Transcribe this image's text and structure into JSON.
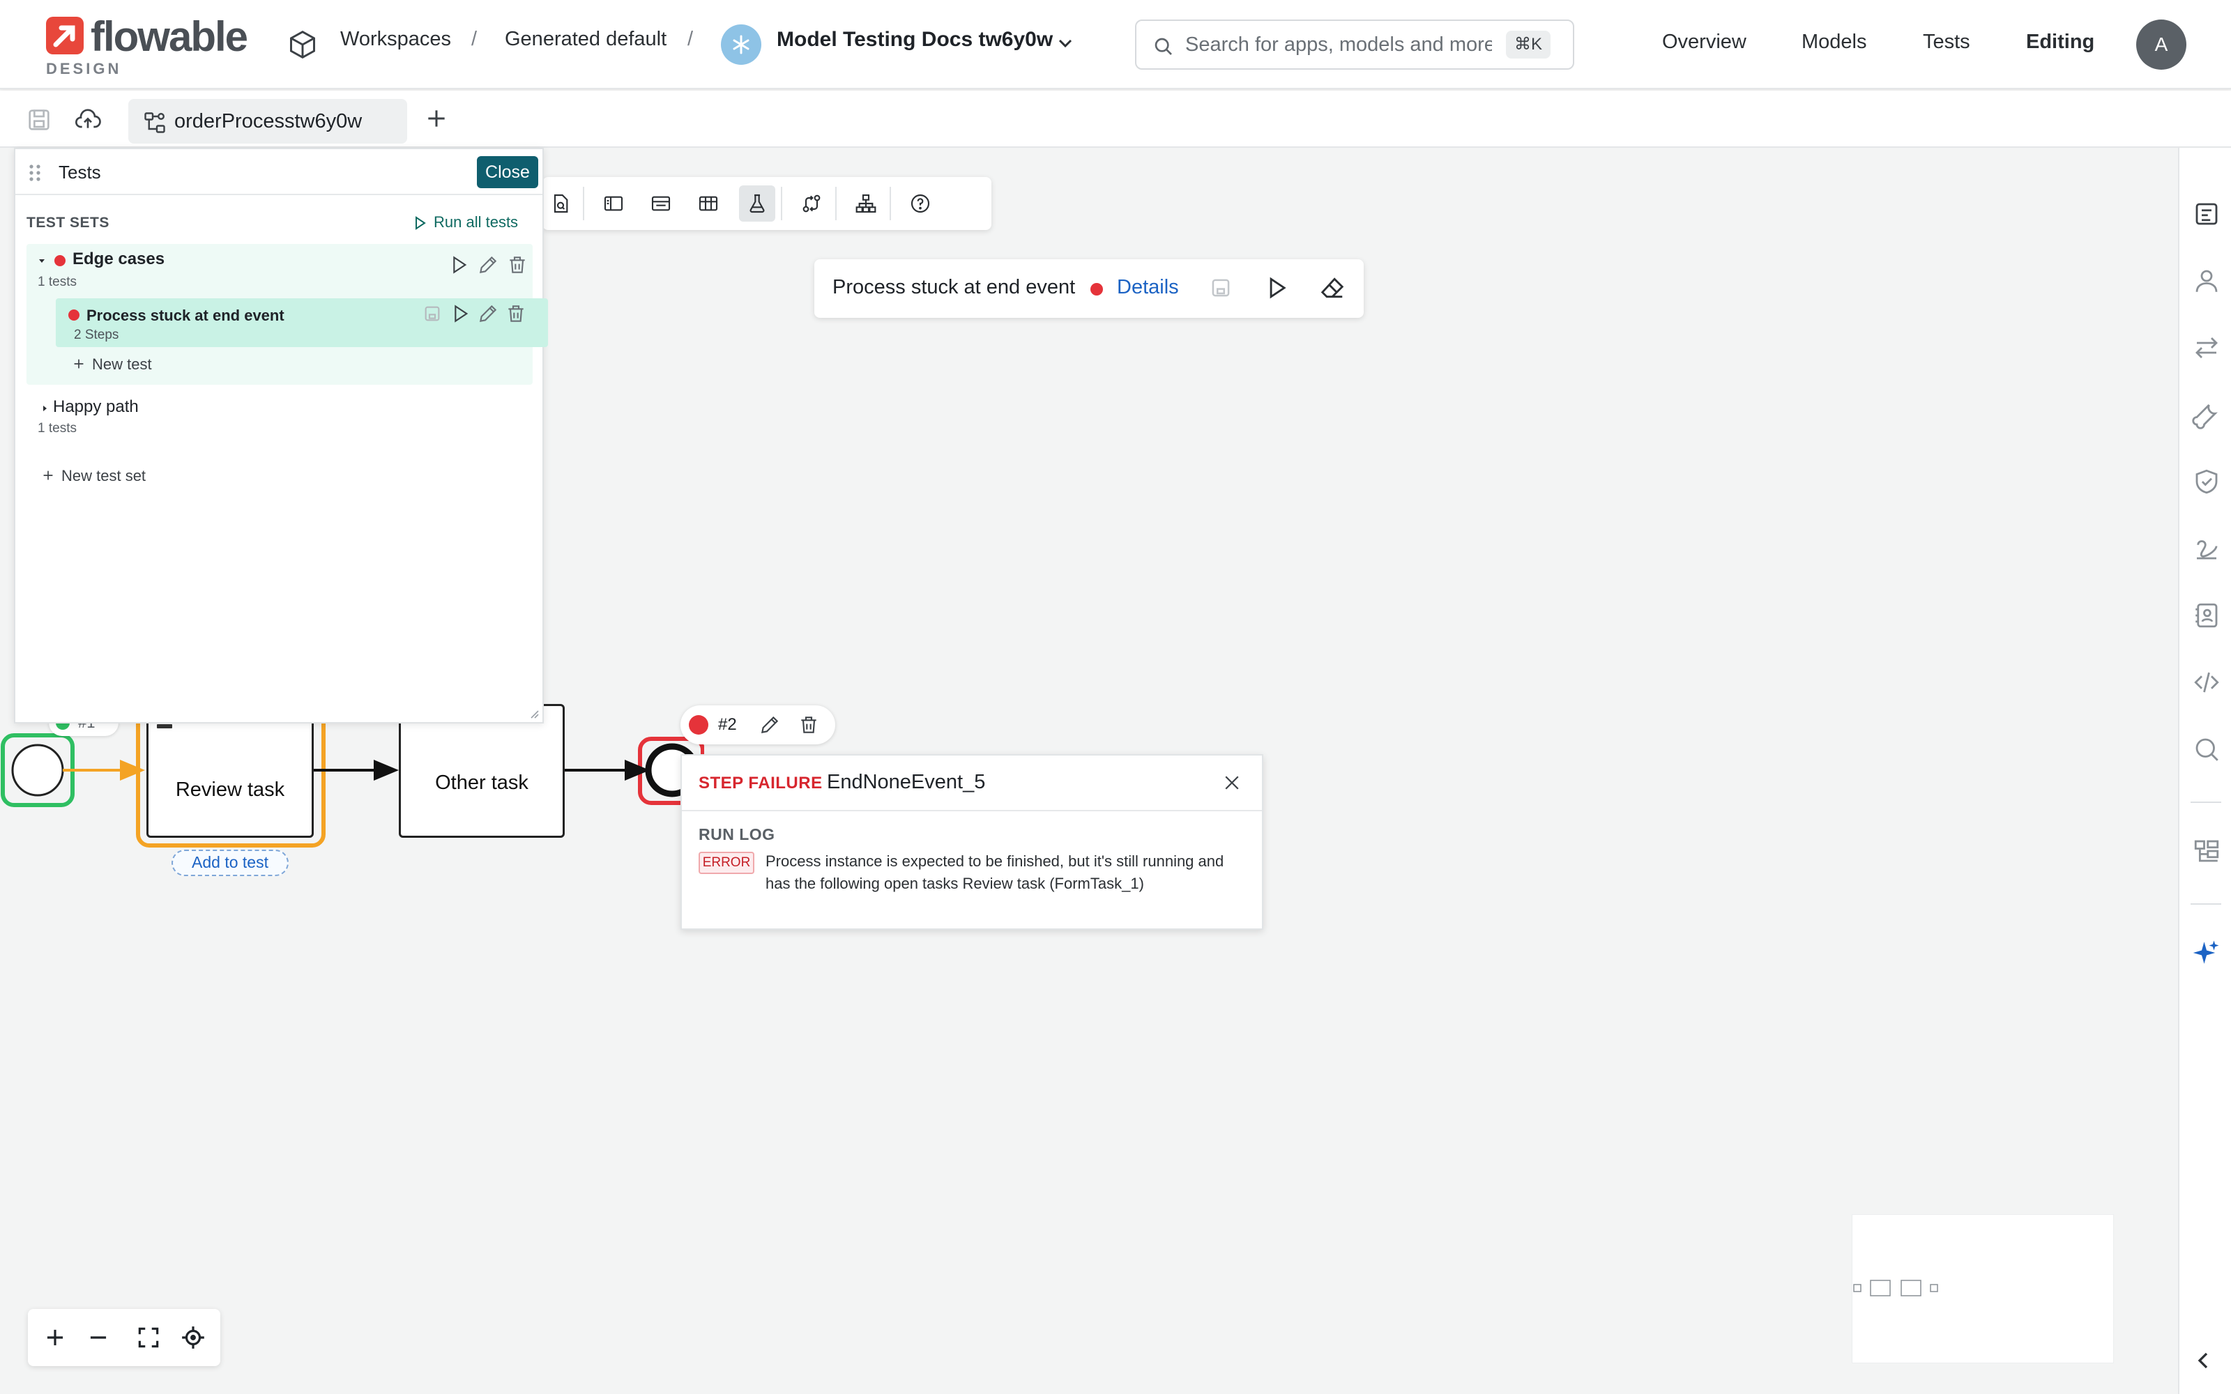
{
  "header": {
    "logo_word": "flowable",
    "logo_sub": "DESIGN",
    "breadcrumb": [
      "Workspaces",
      "Generated default"
    ],
    "breadcrumb_sep": "/",
    "app_title": "Model Testing Docs tw6y0w",
    "search": {
      "placeholder": "Search for apps, models and more",
      "shortcut": "⌘K"
    },
    "nav": [
      "Overview",
      "Models",
      "Tests",
      "Editing"
    ],
    "active_nav": "Editing",
    "avatar": "A"
  },
  "subbar": {
    "model_tab": "orderProcesstw6y0w"
  },
  "toolbar": {
    "buttons": [
      "document-search-icon",
      "panel-left-icon",
      "list-panel-icon",
      "table-icon",
      "flask-icon",
      "git-compare-icon",
      "hierarchy-icon",
      "help-icon"
    ],
    "active": "flask-icon"
  },
  "test_status": {
    "name": "Process stuck at end event",
    "status": "failed",
    "details_link": "Details"
  },
  "tests_panel": {
    "title": "Tests",
    "close_label": "Close",
    "section_label": "TEST SETS",
    "run_all_label": "Run all tests",
    "sets": [
      {
        "name": "Edge cases",
        "count": "1 tests",
        "status": "failed",
        "expanded": true,
        "tests": [
          {
            "name": "Process stuck at end event",
            "steps": "2 Steps",
            "status": "failed"
          }
        ],
        "new_test_label": "New test"
      },
      {
        "name": "Happy path",
        "count": "1 tests",
        "expanded": false
      }
    ],
    "new_set_label": "New test set"
  },
  "diagram": {
    "step1_label": "#1",
    "tasks": [
      "Review task",
      "Other task"
    ],
    "add_to_test_label": "Add to test",
    "step_chip": {
      "label": "#2",
      "status": "failed"
    },
    "failure": {
      "label": "STEP FAILURE",
      "element": "EndNoneEvent_5",
      "run_log_label": "RUN LOG",
      "error_badge": "ERROR",
      "message": "Process instance is expected to be finished, but it's still running and has the following open tasks Review task (FormTask_1)"
    }
  },
  "colors": {
    "accent": "#0f5e6e",
    "failure_red": "#e5333a",
    "success_green": "#2fbf62",
    "active_path_orange": "#f4a324",
    "link_blue": "#1c63c4",
    "test_row_bg": "#c9f2e5"
  }
}
